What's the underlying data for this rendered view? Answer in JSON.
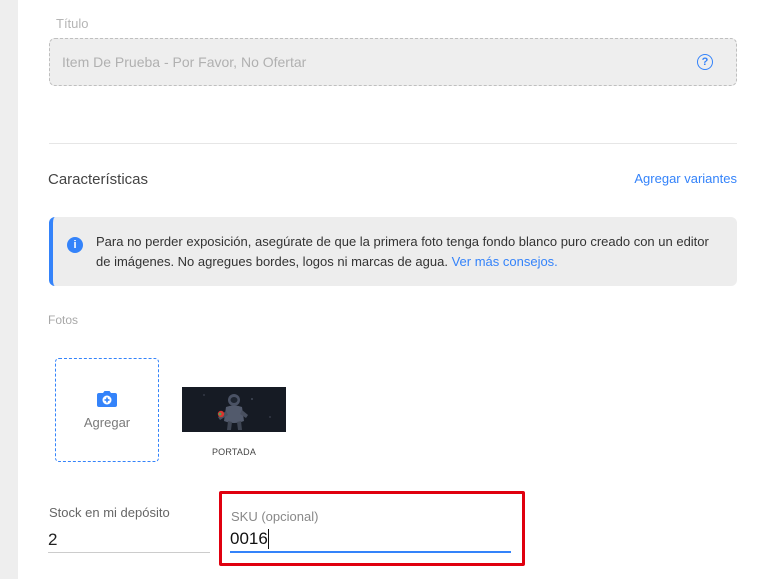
{
  "title_field": {
    "label": "Título",
    "value": "Item De Prueba - Por Favor, No Ofertar",
    "help_icon": "?"
  },
  "characteristics": {
    "heading": "Características",
    "variants_link": "Agregar variantes"
  },
  "info_banner": {
    "icon": "i",
    "text": "Para no perder exposición, asegúrate de que la primera foto tenga fondo blanco puro creado con un editor de imágenes. No agregues bordes, logos ni marcas de agua.",
    "link": "Ver más consejos."
  },
  "photos": {
    "label": "Fotos",
    "add_label": "Agregar",
    "cover_caption": "PORTADA"
  },
  "stock_field": {
    "label": "Stock en mi depósito",
    "value": "2"
  },
  "sku_field": {
    "label": "SKU (opcional)",
    "value": "0016"
  },
  "colors": {
    "accent": "#3483fa",
    "highlight": "#e0000f"
  }
}
